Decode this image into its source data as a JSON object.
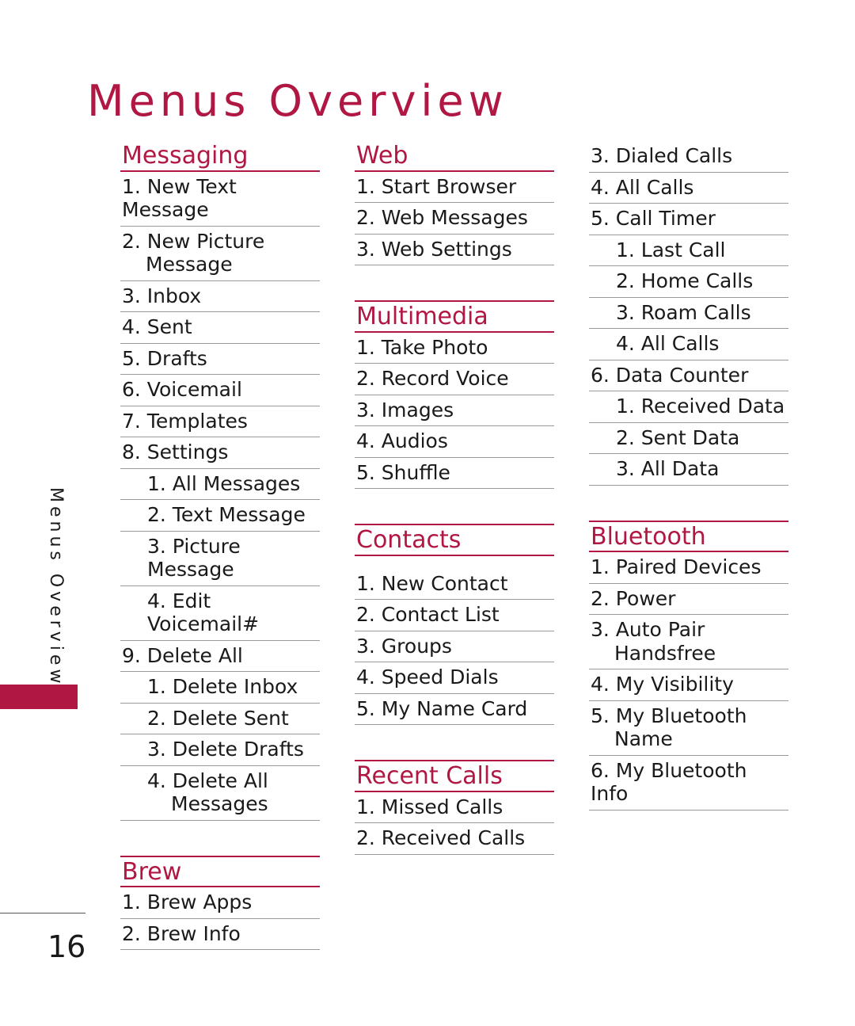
{
  "page": {
    "title": "Menus Overview",
    "side_label": "Menus Overview",
    "number": "16",
    "accent_color": "#B01742",
    "text_color": "#1a1a1a",
    "rule_color": "#9a9a9a"
  },
  "columns": [
    {
      "id": "column-1",
      "sections": [
        {
          "id": "messaging",
          "heading": "Messaging",
          "rule_above": false,
          "head_gap": false,
          "items": [
            {
              "text": "1. New Text Message",
              "level": 1
            },
            {
              "text": "2. New Picture",
              "cont": "Message",
              "level": 1
            },
            {
              "text": "3. Inbox",
              "level": 1
            },
            {
              "text": "4. Sent",
              "level": 1
            },
            {
              "text": "5. Drafts",
              "level": 1
            },
            {
              "text": "6. Voicemail",
              "level": 1
            },
            {
              "text": "7.  Templates",
              "level": 1
            },
            {
              "text": "8. Settings",
              "level": 1
            },
            {
              "text": "1. All Messages",
              "level": 2
            },
            {
              "text": "2. Text Message",
              "level": 2
            },
            {
              "text": "3. Picture Message",
              "level": 2
            },
            {
              "text": "4. Edit Voicemail#",
              "level": 2
            },
            {
              "text": "9. Delete All",
              "level": 1
            },
            {
              "text": "1. Delete Inbox",
              "level": 2
            },
            {
              "text": "2. Delete Sent",
              "level": 2
            },
            {
              "text": "3. Delete Drafts",
              "level": 2
            },
            {
              "text": "4. Delete All",
              "cont": "Messages",
              "level": 2
            }
          ]
        },
        {
          "id": "brew",
          "heading": "Brew",
          "rule_above": true,
          "head_gap": false,
          "items": [
            {
              "text": "1. Brew Apps",
              "level": 1
            },
            {
              "text": "2. Brew Info",
              "level": 1
            }
          ]
        }
      ]
    },
    {
      "id": "column-2",
      "sections": [
        {
          "id": "web",
          "heading": "Web",
          "rule_above": false,
          "head_gap": false,
          "items": [
            {
              "text": "1. Start Browser",
              "level": 1
            },
            {
              "text": "2. Web Messages",
              "level": 1
            },
            {
              "text": "3. Web Settings",
              "level": 1
            }
          ]
        },
        {
          "id": "multimedia",
          "heading": "Multimedia",
          "rule_above": true,
          "head_gap": false,
          "items": [
            {
              "text": "1. Take Photo",
              "level": 1
            },
            {
              "text": "2. Record Voice",
              "level": 1
            },
            {
              "text": "3. Images",
              "level": 1
            },
            {
              "text": "4. Audios",
              "level": 1
            },
            {
              "text": "5. Shuffle",
              "level": 1
            }
          ]
        },
        {
          "id": "contacts",
          "heading": "Contacts",
          "rule_above": true,
          "head_gap": true,
          "items": [
            {
              "text": "1. New Contact",
              "level": 1
            },
            {
              "text": "2. Contact List",
              "level": 1
            },
            {
              "text": "3. Groups",
              "level": 1
            },
            {
              "text": "4. Speed Dials",
              "level": 1
            },
            {
              "text": "5. My Name Card",
              "level": 1
            }
          ]
        },
        {
          "id": "recent-calls",
          "heading": "Recent Calls",
          "rule_above": true,
          "head_gap": false,
          "items": [
            {
              "text": "1. Missed Calls",
              "level": 1
            },
            {
              "text": "2. Received Calls",
              "level": 1
            }
          ]
        }
      ]
    },
    {
      "id": "column-3",
      "sections": [
        {
          "id": "recent-calls-continued",
          "heading": null,
          "rule_above": false,
          "head_gap": false,
          "items": [
            {
              "text": "3. Dialed Calls",
              "level": 1
            },
            {
              "text": "4. All Calls",
              "level": 1
            },
            {
              "text": "5. Call Timer",
              "level": 1
            },
            {
              "text": "1. Last Call",
              "level": 2
            },
            {
              "text": "2. Home Calls",
              "level": 2
            },
            {
              "text": "3. Roam Calls",
              "level": 2
            },
            {
              "text": "4. All Calls",
              "level": 2
            },
            {
              "text": "6. Data Counter",
              "level": 1
            },
            {
              "text": "1. Received Data",
              "level": 2
            },
            {
              "text": "2. Sent Data",
              "level": 2
            },
            {
              "text": "3. All Data",
              "level": 2
            }
          ]
        },
        {
          "id": "bluetooth",
          "heading": "Bluetooth",
          "rule_above": true,
          "head_gap": false,
          "items": [
            {
              "text": "1. Paired Devices",
              "level": 1
            },
            {
              "text": "2. Power",
              "level": 1
            },
            {
              "text": "3. Auto Pair",
              "cont": "Handsfree",
              "level": 1
            },
            {
              "text": "4. My Visibility",
              "level": 1
            },
            {
              "text": "5. My Bluetooth",
              "cont": "Name",
              "level": 1
            },
            {
              "text": "6. My Bluetooth Info",
              "level": 1
            }
          ]
        }
      ]
    }
  ]
}
